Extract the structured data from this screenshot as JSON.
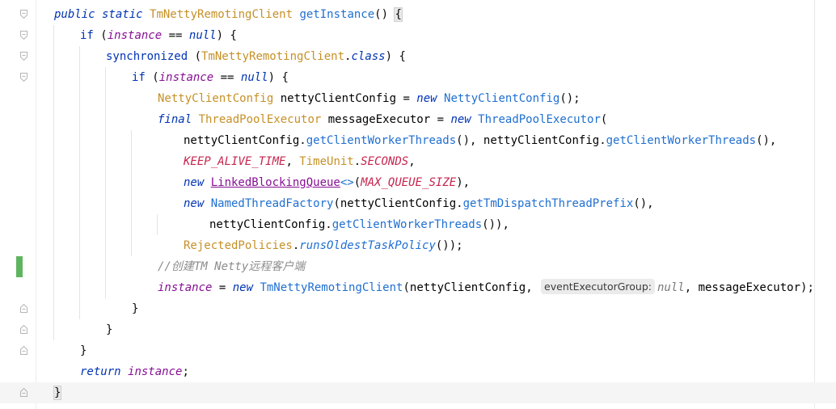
{
  "editor": {
    "language": "java",
    "lines": [
      {
        "fold": "open",
        "guides": [],
        "tokens": [
          [
            "kwi",
            "public static "
          ],
          [
            "cls",
            "TmNettyRemotingClient "
          ],
          [
            "mth",
            "getInstance"
          ],
          [
            "txt",
            "() "
          ],
          [
            "brace",
            "{"
          ]
        ]
      },
      {
        "fold": "open",
        "guides": [
          99
        ],
        "tokens": [
          [
            "kw",
            "if "
          ],
          [
            "txt",
            "("
          ],
          [
            "fld",
            "instance "
          ],
          [
            "txt",
            "== "
          ],
          [
            "kwi",
            "null"
          ],
          [
            "txt",
            ") {"
          ]
        ]
      },
      {
        "fold": "open",
        "guides": [
          99,
          131
        ],
        "tokens": [
          [
            "kw",
            "synchronized "
          ],
          [
            "txt",
            "("
          ],
          [
            "cls",
            "TmNettyRemotingClient"
          ],
          [
            "txt",
            "."
          ],
          [
            "kwi",
            "class"
          ],
          [
            "txt",
            ") {"
          ]
        ]
      },
      {
        "fold": "open",
        "guides": [
          99,
          131,
          163
        ],
        "tokens": [
          [
            "kw",
            "if "
          ],
          [
            "txt",
            "("
          ],
          [
            "fld",
            "instance "
          ],
          [
            "txt",
            "== "
          ],
          [
            "kwi",
            "null"
          ],
          [
            "txt",
            ") {"
          ]
        ]
      },
      {
        "fold": null,
        "guides": [
          99,
          131,
          163
        ],
        "tokens": [
          [
            "cls",
            "NettyClientConfig "
          ],
          [
            "var",
            "nettyClientConfig "
          ],
          [
            "txt",
            "= "
          ],
          [
            "kwi",
            "new "
          ],
          [
            "mth",
            "NettyClientConfig"
          ],
          [
            "txt",
            "();"
          ]
        ]
      },
      {
        "fold": null,
        "guides": [
          99,
          131,
          163
        ],
        "tokens": [
          [
            "kwi",
            "final "
          ],
          [
            "cls",
            "ThreadPoolExecutor "
          ],
          [
            "var",
            "messageExecutor "
          ],
          [
            "txt",
            "= "
          ],
          [
            "kwi",
            "new "
          ],
          [
            "mth",
            "ThreadPoolExecutor"
          ],
          [
            "txt",
            "("
          ]
        ]
      },
      {
        "fold": null,
        "guides": [
          99,
          131,
          163,
          195
        ],
        "tokens": [
          [
            "var",
            "nettyClientConfig"
          ],
          [
            "txt",
            "."
          ],
          [
            "mth",
            "getClientWorkerThreads"
          ],
          [
            "txt",
            "(), "
          ],
          [
            "var",
            "nettyClientConfig"
          ],
          [
            "txt",
            "."
          ],
          [
            "mth",
            "getClientWorkerThreads"
          ],
          [
            "txt",
            "(),"
          ]
        ]
      },
      {
        "fold": null,
        "guides": [
          99,
          131,
          163,
          195
        ],
        "tokens": [
          [
            "const",
            "KEEP_ALIVE_TIME"
          ],
          [
            "txt",
            ", "
          ],
          [
            "cls",
            "TimeUnit"
          ],
          [
            "txt",
            "."
          ],
          [
            "const",
            "SECONDS"
          ],
          [
            "txt",
            ","
          ]
        ]
      },
      {
        "fold": null,
        "guides": [
          99,
          131,
          163,
          195
        ],
        "tokens": [
          [
            "kwi",
            "new "
          ],
          [
            "clsul",
            "LinkedBlockingQueue"
          ],
          [
            "mth",
            "<>"
          ],
          [
            "txt",
            "("
          ],
          [
            "const",
            "MAX_QUEUE_SIZE"
          ],
          [
            "txt",
            "),"
          ]
        ]
      },
      {
        "fold": null,
        "guides": [
          99,
          131,
          163,
          195
        ],
        "tokens": [
          [
            "kwi",
            "new "
          ],
          [
            "mth",
            "NamedThreadFactory"
          ],
          [
            "txt",
            "("
          ],
          [
            "var",
            "nettyClientConfig"
          ],
          [
            "txt",
            "."
          ],
          [
            "mth",
            "getTmDispatchThreadPrefix"
          ],
          [
            "txt",
            "(),"
          ]
        ]
      },
      {
        "fold": null,
        "guides": [
          99,
          131,
          163,
          195,
          227
        ],
        "tokens": [
          [
            "var",
            "nettyClientConfig"
          ],
          [
            "txt",
            "."
          ],
          [
            "mth",
            "getClientWorkerThreads"
          ],
          [
            "txt",
            "()),"
          ]
        ]
      },
      {
        "fold": null,
        "guides": [
          99,
          131,
          163,
          195
        ],
        "tokens": [
          [
            "cls",
            "RejectedPolicies"
          ],
          [
            "txt",
            "."
          ],
          [
            "mthi",
            "runsOldestTaskPolicy"
          ],
          [
            "txt",
            "());"
          ]
        ]
      },
      {
        "fold": null,
        "vcs": true,
        "guides": [
          99,
          131,
          163
        ],
        "tokens": [
          [
            "cmt",
            "//创建TM Netty远程客户端"
          ]
        ]
      },
      {
        "fold": null,
        "guides": [
          99,
          131,
          163
        ],
        "tokens": [
          [
            "fld",
            "instance "
          ],
          [
            "txt",
            "= "
          ],
          [
            "kwi",
            "new "
          ],
          [
            "mth",
            "TmNettyRemotingClient"
          ],
          [
            "txt",
            "("
          ],
          [
            "var",
            "nettyClientConfig"
          ],
          [
            "txt",
            ", "
          ],
          [
            "hint",
            "eventExecutorGroup:"
          ],
          [
            "hint-kw",
            "null"
          ],
          [
            "txt",
            ", "
          ],
          [
            "var",
            "messageExecutor"
          ],
          [
            "txt",
            ");"
          ]
        ]
      },
      {
        "fold": "close",
        "guides": [
          99,
          131
        ],
        "tokens": [
          [
            "txt",
            "}"
          ]
        ]
      },
      {
        "fold": "close",
        "guides": [
          99
        ],
        "tokens": [
          [
            "txt",
            "}"
          ]
        ]
      },
      {
        "fold": "close",
        "guides": [],
        "tokens": [
          [
            "txt",
            "}"
          ]
        ]
      },
      {
        "fold": null,
        "guides": [],
        "tokens": [
          [
            "kwi",
            "return "
          ],
          [
            "fld",
            "instance"
          ],
          [
            "txt",
            ";"
          ]
        ]
      },
      {
        "fold": "close",
        "current": true,
        "guides": [],
        "tokens": [
          [
            "brace",
            "}"
          ]
        ]
      }
    ],
    "indent": [
      0,
      1,
      2,
      3,
      4,
      4,
      5,
      5,
      5,
      5,
      6,
      5,
      4,
      4,
      3,
      2,
      1,
      1,
      0
    ]
  }
}
